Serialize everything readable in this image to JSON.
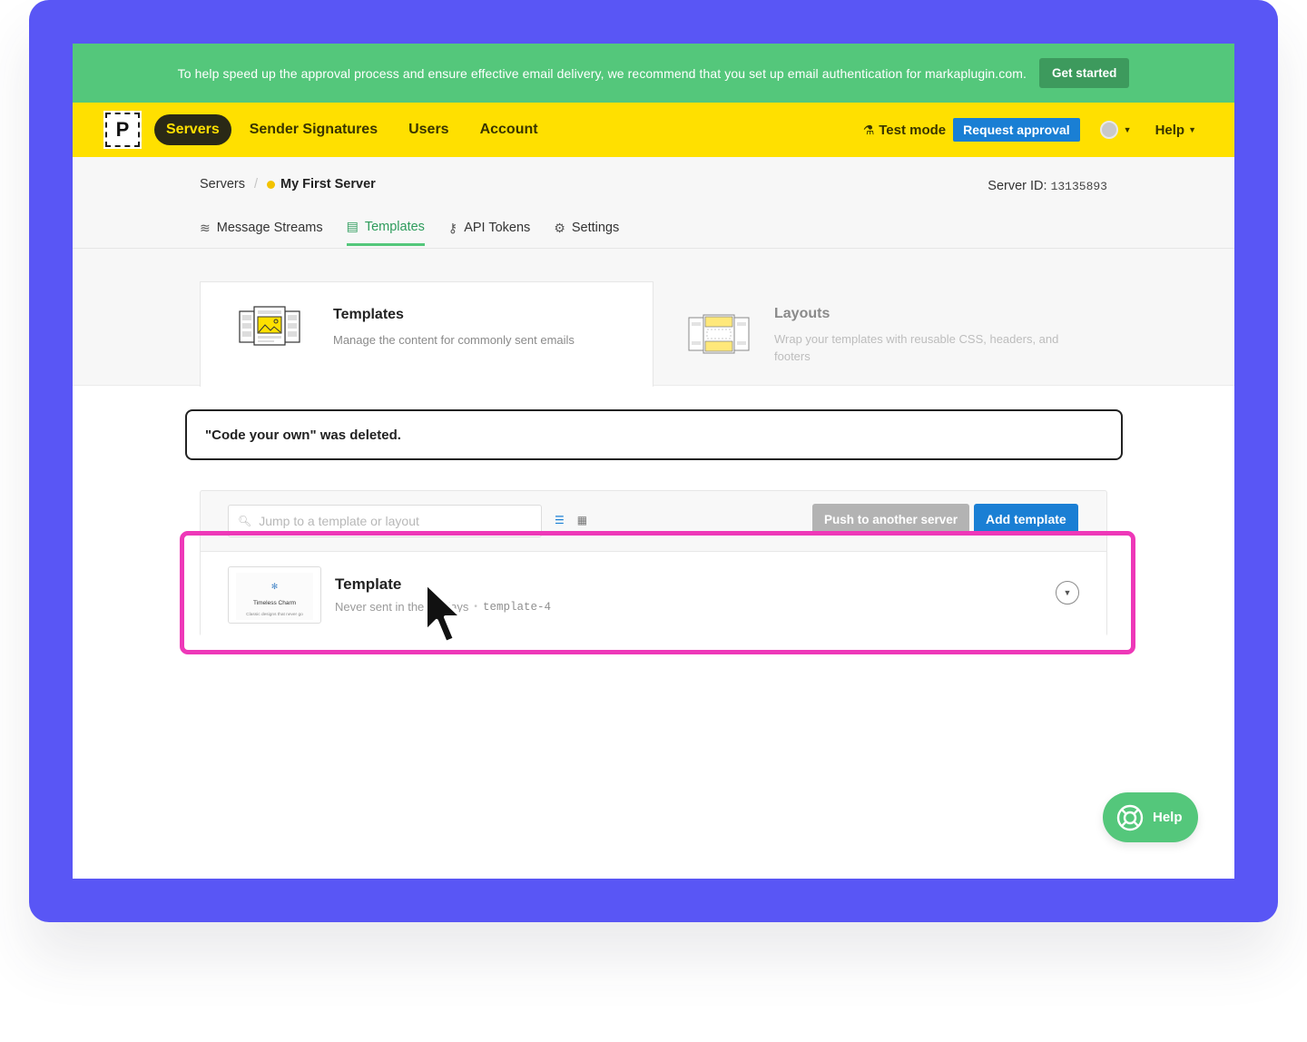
{
  "banner": {
    "text": "To help speed up the approval process and ensure effective email delivery, we recommend that you set up email authentication for markaplugin.com.",
    "cta_label": "Get started"
  },
  "nav": {
    "logo_letter": "P",
    "items": [
      {
        "label": "Servers",
        "active": true
      },
      {
        "label": "Sender Signatures"
      },
      {
        "label": "Users"
      },
      {
        "label": "Account"
      }
    ],
    "test_mode_label": "Test mode",
    "request_approval_label": "Request approval",
    "help_label": "Help"
  },
  "server": {
    "breadcrumb_root": "Servers",
    "breadcrumb_current": "My First Server",
    "id_label": "Server ID:",
    "id_value": "13135893",
    "tabs": [
      {
        "label": "Message Streams",
        "icon": "layers-icon"
      },
      {
        "label": "Templates",
        "icon": "template-icon",
        "active": true
      },
      {
        "label": "API Tokens",
        "icon": "key-icon"
      },
      {
        "label": "Settings",
        "icon": "gear-icon"
      }
    ]
  },
  "types": {
    "templates": {
      "title": "Templates",
      "description": "Manage the content for commonly sent emails"
    },
    "layouts": {
      "title": "Layouts",
      "description": "Wrap your templates with reusable CSS, headers, and footers"
    }
  },
  "notice": {
    "text": "\"Code your own\" was deleted."
  },
  "list": {
    "search_placeholder": "Jump to a template or layout",
    "push_label": "Push to another server",
    "add_label": "Add template",
    "items": [
      {
        "name": "Template",
        "meta": "Never sent in the 30 days",
        "alias": "template-4",
        "thumb_title": "Timeless Charm",
        "thumb_subtitle": "Classic designs that never go"
      }
    ]
  },
  "help_fab": {
    "label": "Help"
  },
  "colors": {
    "background_frame": "#5956f5",
    "banner": "#54c77b",
    "nav": "#ffe000",
    "primary_blue": "#1a7fd4",
    "highlight": "#ee38b8"
  }
}
